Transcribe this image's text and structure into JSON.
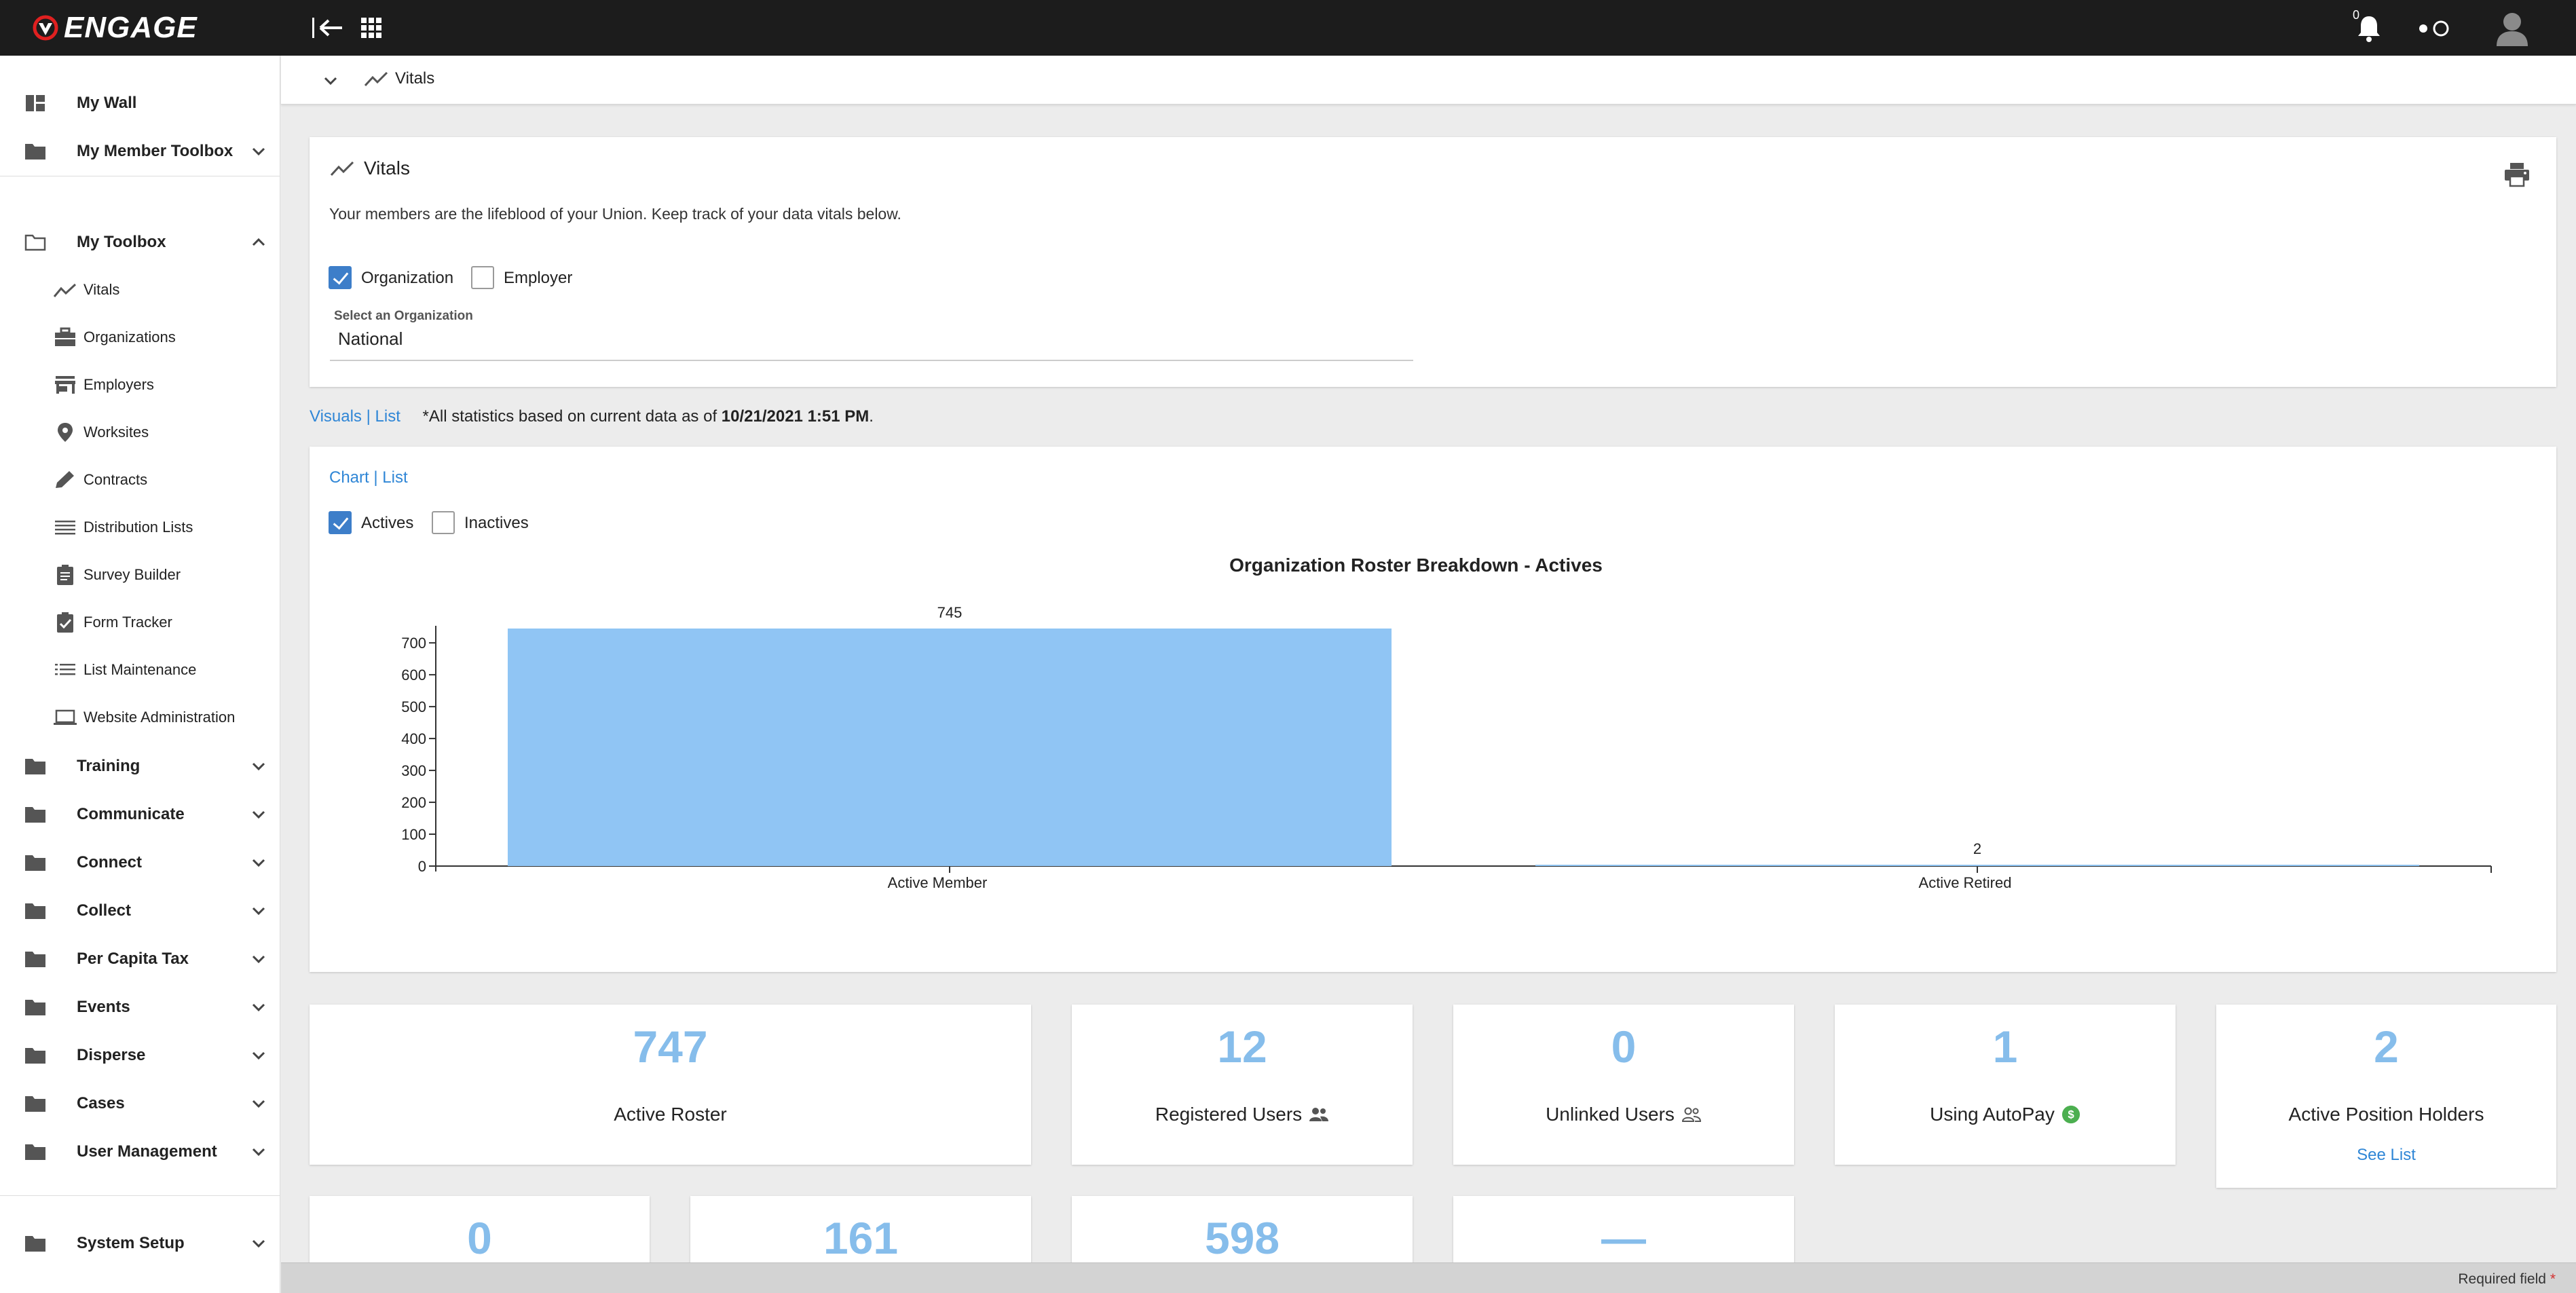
{
  "app": {
    "logo_text": "ENGAGE",
    "brand_color": "#1c1c1c",
    "accent_color": "#3d7ec9",
    "link_color": "#2f86d6"
  },
  "topbar": {
    "notification_count": "0",
    "icons": [
      "collapse-sidebar-icon",
      "apps-grid-icon",
      "bell-icon",
      "toggle-icon",
      "avatar-icon"
    ]
  },
  "sidebar": {
    "my_wall": "My Wall",
    "my_member_toolbox": "My Member Toolbox",
    "my_toolbox": "My Toolbox",
    "toolbox_items": [
      "Vitals",
      "Organizations",
      "Employers",
      "Worksites",
      "Contracts",
      "Distribution Lists",
      "Survey Builder",
      "Form Tracker",
      "List Maintenance",
      "Website Administration"
    ],
    "groups": [
      "Training",
      "Communicate",
      "Connect",
      "Collect",
      "Per Capita Tax",
      "Events",
      "Disperse",
      "Cases",
      "User Management"
    ],
    "system_setup": "System Setup"
  },
  "breadcrumb": {
    "label": "Vitals"
  },
  "vitals": {
    "title": "Vitals",
    "description": "Your members are the lifeblood of your Union. Keep track of your data vitals below.",
    "filter_organization": "Organization",
    "filter_employer": "Employer",
    "select_label": "Select an Organization",
    "select_value": "National"
  },
  "view_toggle": {
    "visuals": "Visuals",
    "sep": "|",
    "list": "List",
    "note_prefix": "*All statistics based on current data as of ",
    "note_date": "10/21/2021 1:51 PM",
    "note_suffix": "."
  },
  "chart_toggle": {
    "chart": "Chart",
    "sep": "|",
    "list": "List",
    "actives": "Actives",
    "inactives": "Inactives"
  },
  "chart_data": {
    "type": "bar",
    "title": "Organization Roster Breakdown - Actives",
    "categories": [
      "Active Member",
      "Active Retired"
    ],
    "values": [
      745,
      2
    ],
    "ylim": [
      0,
      745
    ],
    "yticks": [
      0,
      100,
      200,
      300,
      400,
      500,
      600,
      700
    ],
    "bar_color": "#90c5f4",
    "grid": false
  },
  "tiles_row1": [
    {
      "num": "747",
      "label": "Active Roster"
    },
    {
      "num": "12",
      "label": "Registered Users"
    },
    {
      "num": "0",
      "label": "Unlinked Users"
    },
    {
      "num": "1",
      "label": "Using AutoPay"
    },
    {
      "num": "2",
      "label": "Active Position Holders",
      "link": "See List"
    }
  ],
  "tiles_row2": [
    {
      "num": "0"
    },
    {
      "num": "161"
    },
    {
      "num": "598"
    },
    {
      "num": "—"
    }
  ],
  "footer": {
    "required_text": "Required field",
    "star": "*"
  }
}
